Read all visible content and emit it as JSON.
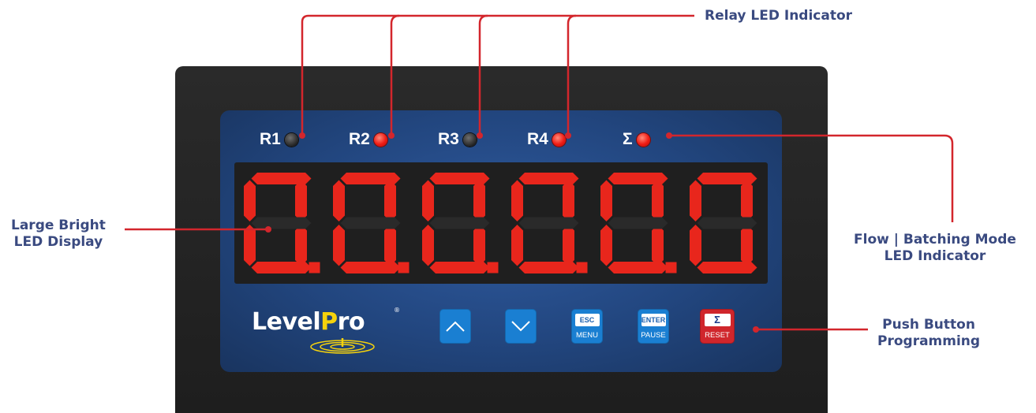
{
  "callouts": {
    "relay": "Relay LED Indicator",
    "display_line1": "Large Bright",
    "display_line2": "LED Display",
    "batch_line1": "Flow | Batching Mode",
    "batch_line2": "LED Indicator",
    "buttons_line1": "Push Button",
    "buttons_line2": "Programming"
  },
  "leds": [
    {
      "label": "R1",
      "state": "off"
    },
    {
      "label": "R2",
      "state": "on"
    },
    {
      "label": "R3",
      "state": "off"
    },
    {
      "label": "R4",
      "state": "on"
    },
    {
      "label": "Σ",
      "state": "on"
    }
  ],
  "display": {
    "reading": "0.0.0.0.0.0",
    "digit_color": "#e8261c"
  },
  "logo": {
    "text_before": "Level",
    "text_p": "P",
    "text_after": "ro",
    "registered": "®"
  },
  "buttons": {
    "up_icon": "chevron-up-icon",
    "down_icon": "chevron-down-icon",
    "esc_top": "ESC",
    "esc_bottom": "MENU",
    "enter_top": "ENTER",
    "enter_bottom": "PAUSE",
    "reset_top": "Σ",
    "reset_bottom": "RESET"
  },
  "colors": {
    "callout_line": "#d3262c",
    "label_text": "#3a4a80",
    "faceplate": "#22467f",
    "button_blue": "#1a7fd2",
    "button_red": "#d0262c"
  }
}
